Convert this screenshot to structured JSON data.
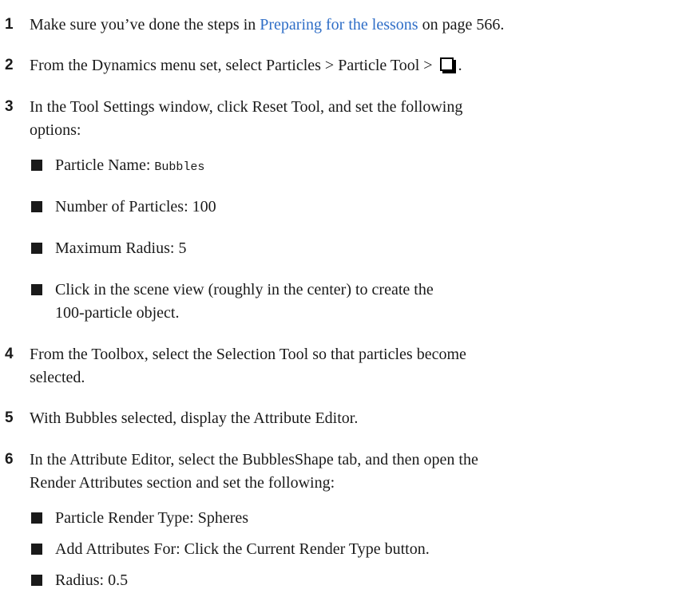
{
  "steps": [
    {
      "number": "1",
      "text_before": "Make sure you’ve done the steps in ",
      "link_text": "Preparing for the lessons",
      "text_after": " on page 566."
    },
    {
      "number": "2",
      "text_before": "From the Dynamics menu set, select Particles > Particle Tool > ",
      "icon": "option-box-icon",
      "text_after": "."
    },
    {
      "number": "3",
      "line1": "In the Tool Settings window, click Reset Tool, and set the following",
      "line2": "options:",
      "bullets": [
        {
          "label": "Particle Name: ",
          "code": "Bubbles"
        },
        {
          "text": "Number of Particles: 100"
        },
        {
          "text": "Maximum Radius: 5"
        },
        {
          "line1": "Click in the scene view (roughly in the center) to create the",
          "line2": "100-particle object."
        }
      ]
    },
    {
      "number": "4",
      "line1": "From the Toolbox, select the Selection Tool so that particles become",
      "line2": "selected."
    },
    {
      "number": "5",
      "text": "With Bubbles selected, display the Attribute Editor."
    },
    {
      "number": "6",
      "line1": "In the Attribute Editor, select the BubblesShape tab, and then open the",
      "line2": "Render Attributes section and set the following:",
      "bullets": [
        {
          "text": "Particle Render Type: Spheres"
        },
        {
          "text": "Add Attributes For: Click the Current Render Type button."
        },
        {
          "text": "Radius: 0.5"
        }
      ]
    }
  ]
}
